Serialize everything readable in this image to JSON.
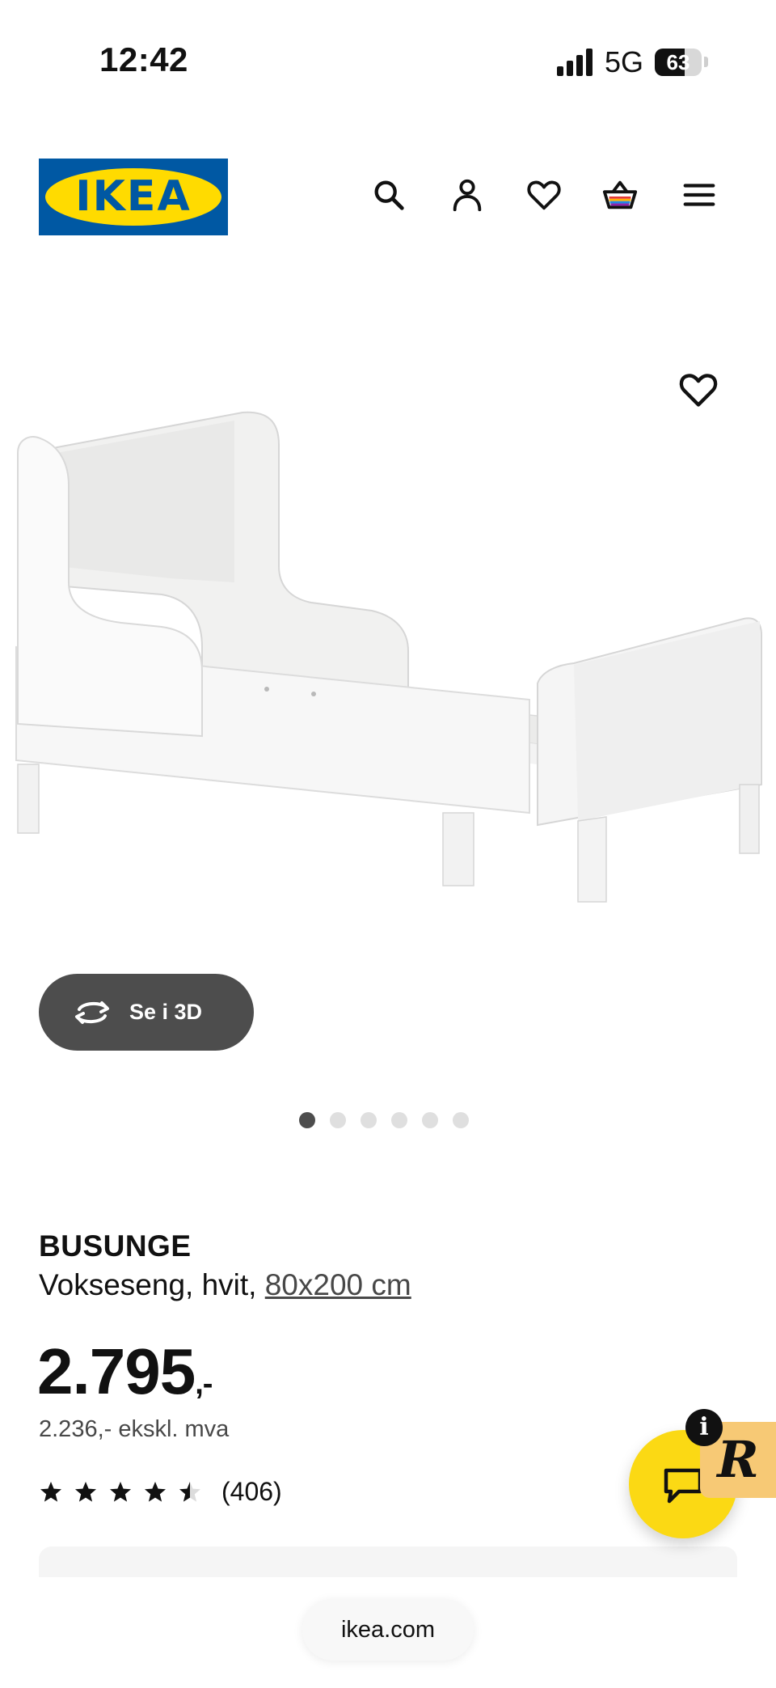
{
  "status_bar": {
    "time": "12:42",
    "network": "5G",
    "battery": "63"
  },
  "header": {
    "logo_text": "IKEA",
    "icons": [
      "search-icon",
      "profile-icon",
      "heart-icon",
      "basket-icon",
      "menu-icon"
    ]
  },
  "gallery": {
    "view_3d_label": "Se i 3D",
    "image_count": 6,
    "active_image": 1
  },
  "product": {
    "name": "BUSUNGE",
    "description": "Vokseseng, hvit, ",
    "size_link": "80x200 cm",
    "price_main": "2.795",
    "price_suffix": ",-",
    "price_ex_vat": "2.236,- ekskl. mva",
    "rating_value": 4.5,
    "rating_max": 5,
    "review_count": "(406)"
  },
  "chat": {
    "info_label": "i",
    "badge_label": "R"
  },
  "browser": {
    "url": "ikea.com"
  },
  "colors": {
    "ikea_blue": "#0058a3",
    "ikea_yellow": "#ffdb00",
    "chat_yellow": "#fbd914",
    "button_dark": "#4d4d4d"
  }
}
